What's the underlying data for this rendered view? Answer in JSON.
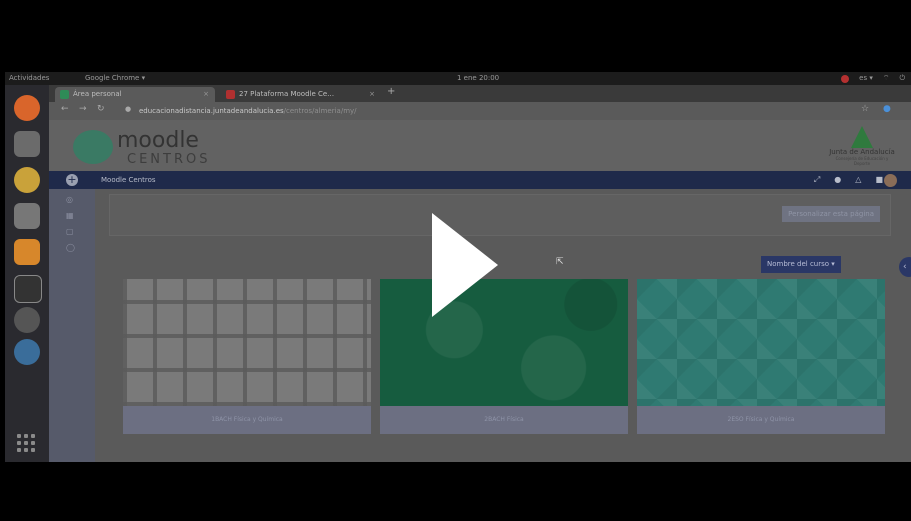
{
  "topbar": {
    "activities": "Actividades",
    "app_menu": "Google Chrome ▾",
    "clock": "1 ene 20:00",
    "system": "es ▾"
  },
  "browser": {
    "tabs": [
      {
        "label": "Área personal",
        "favicon_color": "#2e8b57"
      },
      {
        "label": "27 Plataforma Moodle Ce…",
        "favicon_color": "#b03030"
      }
    ],
    "url_host": "educacionadistancia.juntadeandalucia.es",
    "url_path": "/centros/almeria/my/"
  },
  "page": {
    "logo_word": "moodle",
    "logo_sub": "CENTROS",
    "ja_title": "Junta de Andalucía",
    "ja_subtitle": "Consejería de Educación y Deporte",
    "nav_title": "Moodle Centros",
    "personalize_button": "Personalizar esta página",
    "sort_button": "Nombre del curso ▾",
    "courses": [
      {
        "name": "1BACH Física y Química"
      },
      {
        "name": "2BACH Física"
      },
      {
        "name": "2ESO Física y Química"
      }
    ]
  },
  "colors": {
    "navbar": "#1f2a4a",
    "sort_button": "#2a3766"
  }
}
